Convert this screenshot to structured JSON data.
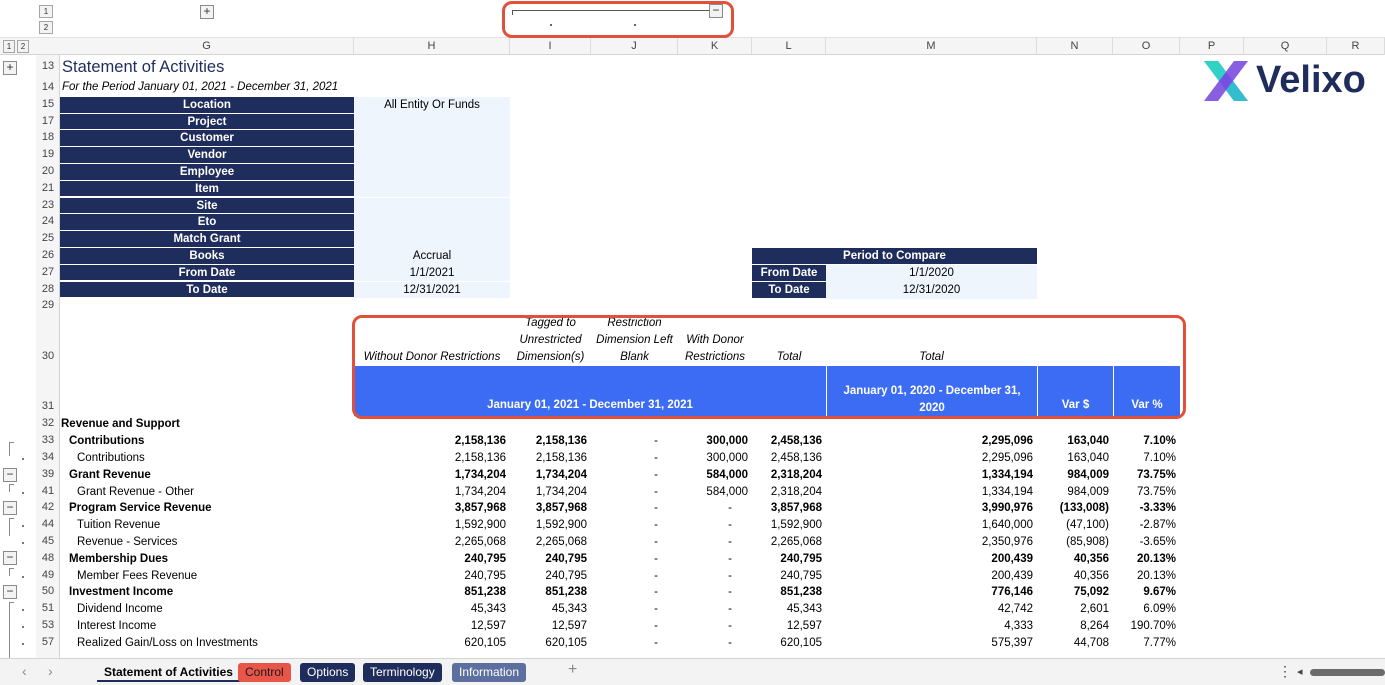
{
  "outline": {
    "levels_top": [
      "1",
      "2"
    ],
    "levels_left": [
      "1",
      "2"
    ],
    "expand_symbol": "+",
    "collapse_symbol": "−"
  },
  "columns": [
    "G",
    "H",
    "I",
    "J",
    "K",
    "L",
    "M",
    "N",
    "O",
    "P",
    "Q",
    "R"
  ],
  "report": {
    "title": "Statement of Activities",
    "subtitle": "For the Period January 01, 2021 - December 31, 2021"
  },
  "filters": [
    {
      "row": "15",
      "label": "Location",
      "value": "All Entity Or Funds"
    },
    {
      "row": "17",
      "label": "Project",
      "value": ""
    },
    {
      "row": "18",
      "label": "Customer",
      "value": ""
    },
    {
      "row": "19",
      "label": "Vendor",
      "value": ""
    },
    {
      "row": "20",
      "label": "Employee",
      "value": ""
    },
    {
      "row": "21",
      "label": "Item",
      "value": ""
    },
    {
      "row": "23",
      "label": "Site",
      "value": ""
    },
    {
      "row": "24",
      "label": "Eto",
      "value": ""
    },
    {
      "row": "25",
      "label": "Match Grant",
      "value": ""
    },
    {
      "row": "26",
      "label": "Books",
      "value": "Accrual"
    },
    {
      "row": "27",
      "label": "From Date",
      "value": "1/1/2021"
    },
    {
      "row": "28",
      "label": "To Date",
      "value": "12/31/2021"
    }
  ],
  "compare": {
    "title": "Period to Compare",
    "from_label": "From Date",
    "from_value": "1/1/2020",
    "to_label": "To Date",
    "to_value": "12/31/2020"
  },
  "extra_rows": [
    "29",
    "30",
    "31"
  ],
  "headers": {
    "h": "Without Donor Restrictions",
    "i": [
      "Tagged to",
      "Unrestricted",
      "Dimension(s)"
    ],
    "j": [
      "Restriction",
      "Dimension Left",
      "Blank"
    ],
    "k": [
      "With Donor",
      "Restrictions"
    ],
    "l": "Total",
    "m": "Total",
    "band_2021": "January 01, 2021 - December 31, 2021",
    "band_2020": [
      "January 01, 2020 - December 31,",
      "2020"
    ],
    "var_dollar": "Var $",
    "var_pct": "Var %"
  },
  "rows": [
    {
      "row": "32",
      "label": "Revenue and Support",
      "bold": true,
      "indent": 0,
      "h": "",
      "i": "",
      "j": "",
      "k": "",
      "l": "",
      "m": "",
      "n": "",
      "o": ""
    },
    {
      "row": "33",
      "label": "Contributions",
      "bold": true,
      "indent": 1,
      "h": "2,158,136",
      "i": "2,158,136",
      "j": "-",
      "k": "300,000",
      "l": "2,458,136",
      "m": "2,295,096",
      "n": "163,040",
      "o": "7.10%"
    },
    {
      "row": "34",
      "label": "Contributions",
      "bold": false,
      "indent": 2,
      "h": "2,158,136",
      "i": "2,158,136",
      "j": "-",
      "k": "300,000",
      "l": "2,458,136",
      "m": "2,295,096",
      "n": "163,040",
      "o": "7.10%"
    },
    {
      "row": "39",
      "label": "Grant Revenue",
      "bold": true,
      "indent": 1,
      "h": "1,734,204",
      "i": "1,734,204",
      "j": "-",
      "k": "584,000",
      "l": "2,318,204",
      "m": "1,334,194",
      "n": "984,009",
      "o": "73.75%"
    },
    {
      "row": "41",
      "label": "Grant Revenue - Other",
      "bold": false,
      "indent": 2,
      "h": "1,734,204",
      "i": "1,734,204",
      "j": "-",
      "k": "584,000",
      "l": "2,318,204",
      "m": "1,334,194",
      "n": "984,009",
      "o": "73.75%"
    },
    {
      "row": "42",
      "label": "Program Service Revenue",
      "bold": true,
      "indent": 1,
      "h": "3,857,968",
      "i": "3,857,968",
      "j": "-",
      "k": "-",
      "l": "3,857,968",
      "m": "3,990,976",
      "n": "(133,008)",
      "o": "-3.33%"
    },
    {
      "row": "44",
      "label": "Tuition Revenue",
      "bold": false,
      "indent": 2,
      "h": "1,592,900",
      "i": "1,592,900",
      "j": "-",
      "k": "-",
      "l": "1,592,900",
      "m": "1,640,000",
      "n": "(47,100)",
      "o": "-2.87%"
    },
    {
      "row": "45",
      "label": "Revenue - Services",
      "bold": false,
      "indent": 2,
      "h": "2,265,068",
      "i": "2,265,068",
      "j": "-",
      "k": "-",
      "l": "2,265,068",
      "m": "2,350,976",
      "n": "(85,908)",
      "o": "-3.65%"
    },
    {
      "row": "48",
      "label": "Membership Dues",
      "bold": true,
      "indent": 1,
      "h": "240,795",
      "i": "240,795",
      "j": "-",
      "k": "-",
      "l": "240,795",
      "m": "200,439",
      "n": "40,356",
      "o": "20.13%"
    },
    {
      "row": "49",
      "label": "Member Fees Revenue",
      "bold": false,
      "indent": 2,
      "h": "240,795",
      "i": "240,795",
      "j": "-",
      "k": "-",
      "l": "240,795",
      "m": "200,439",
      "n": "40,356",
      "o": "20.13%"
    },
    {
      "row": "50",
      "label": "Investment Income",
      "bold": true,
      "indent": 1,
      "h": "851,238",
      "i": "851,238",
      "j": "-",
      "k": "-",
      "l": "851,238",
      "m": "776,146",
      "n": "75,092",
      "o": "9.67%"
    },
    {
      "row": "51",
      "label": "Dividend Income",
      "bold": false,
      "indent": 2,
      "h": "45,343",
      "i": "45,343",
      "j": "-",
      "k": "-",
      "l": "45,343",
      "m": "42,742",
      "n": "2,601",
      "o": "6.09%"
    },
    {
      "row": "53",
      "label": "Interest Income",
      "bold": false,
      "indent": 2,
      "h": "12,597",
      "i": "12,597",
      "j": "-",
      "k": "-",
      "l": "12,597",
      "m": "4,333",
      "n": "8,264",
      "o": "190.70%"
    },
    {
      "row": "57",
      "label": "Realized Gain/Loss on Investments",
      "bold": false,
      "indent": 2,
      "h": "620,105",
      "i": "620,105",
      "j": "-",
      "k": "-",
      "l": "620,105",
      "m": "575,397",
      "n": "44,708",
      "o": "7.77%"
    }
  ],
  "logo": {
    "text": "Velixo",
    "mark_colors": [
      "#2fd3c6",
      "#3c6cf3",
      "#7b4ce0"
    ]
  },
  "tabs": [
    {
      "label": "Statement of Activities",
      "active": true,
      "bg": "#f3f3f3",
      "fg": "#1f2d5c"
    },
    {
      "label": "Control",
      "active": false,
      "bg": "#e8564a",
      "fg": "#1a1a1a"
    },
    {
      "label": "Options",
      "active": false,
      "bg": "#1f2d5c",
      "fg": "#ffffff"
    },
    {
      "label": "Terminology",
      "active": false,
      "bg": "#1f2d5c",
      "fg": "#ffffff"
    },
    {
      "label": "Information",
      "active": false,
      "bg": "#5d6f9e",
      "fg": "#ffffff"
    }
  ],
  "tabbar": {
    "prev": "‹",
    "next": "›",
    "add": "+",
    "more": "⋮",
    "scroll_left": "◂"
  }
}
